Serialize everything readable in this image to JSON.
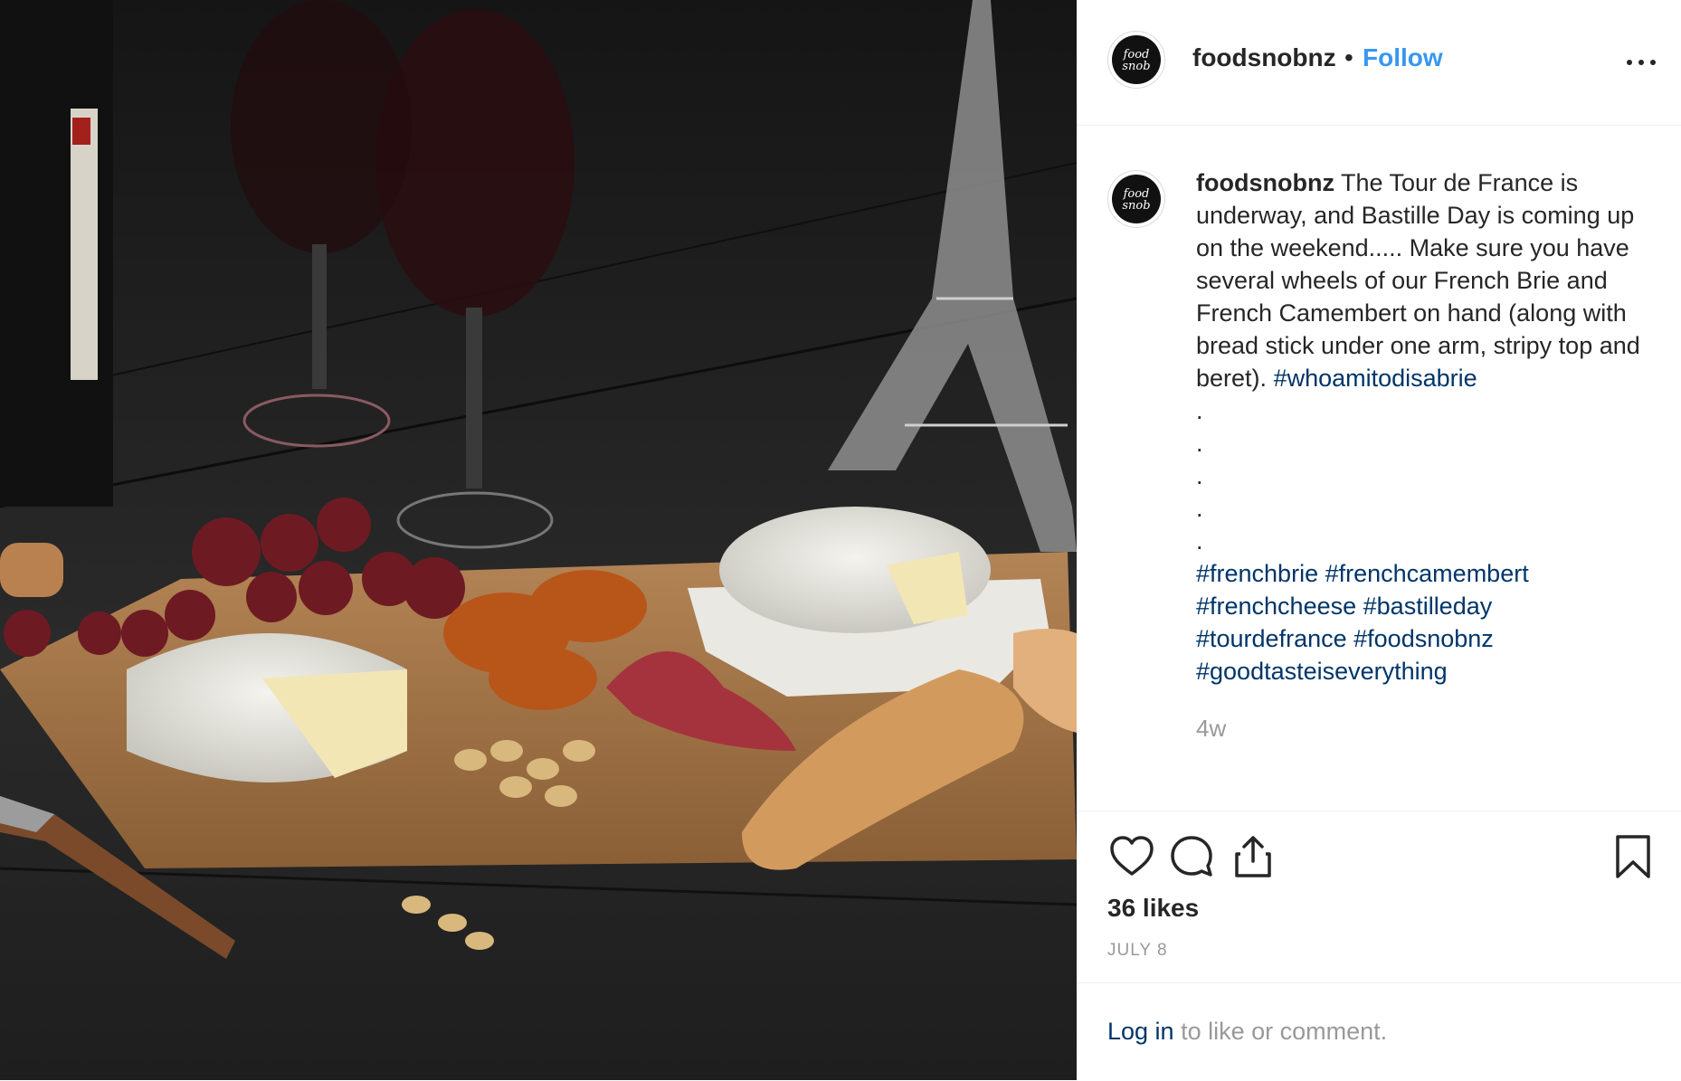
{
  "colors": {
    "follow_blue": "#3897f0",
    "hashtag_navy": "#003569",
    "muted_gray": "#999999",
    "text_dark": "#262626"
  },
  "photo": {
    "alt_semantic": "cheese-board-photo"
  },
  "header": {
    "username": "foodsnobnz",
    "separator": "•",
    "follow_label": "Follow",
    "avatar_icon": "foodsnob-logo-icon",
    "more_icon": "more-options-icon"
  },
  "post": {
    "username": "foodsnobnz",
    "caption_text": "The Tour de France is underway, and Bastille Day is coming up on the weekend..... Make sure you have several wheels of our French Brie and French Camembert on hand (along with bread stick under one arm, stripy top and beret).",
    "caption_tag": "#whoamitodisabrie",
    "dots": [
      ".",
      ".",
      ".",
      ".",
      "."
    ],
    "hashtag_lines": [
      [
        "#frenchbrie",
        "#frenchcamembert"
      ],
      [
        "#frenchcheese",
        "#bastilleday"
      ],
      [
        "#tourdefrance",
        "#foodsnobnz"
      ],
      [
        "#goodtasteiseverything"
      ]
    ],
    "time_ago": "4w"
  },
  "actions": {
    "like_icon": "heart-icon",
    "comment_icon": "comment-icon",
    "share_icon": "share-icon",
    "save_icon": "bookmark-icon",
    "likes_text": "36 likes",
    "date_text": "JULY 8"
  },
  "footer": {
    "login_link": "Log in",
    "login_rest": " to like or comment."
  }
}
